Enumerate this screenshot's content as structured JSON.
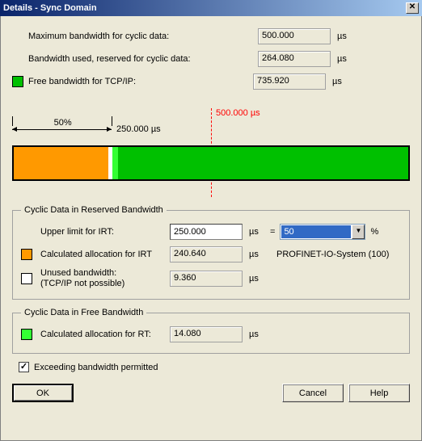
{
  "title": "Details - Sync Domain",
  "top": {
    "max_bw_label": "Maximum bandwidth for cyclic data:",
    "max_bw_value": "500.000",
    "used_bw_label": "Bandwidth used, reserved for cyclic data:",
    "used_bw_value": "264.080",
    "free_bw_label": "Free bandwidth for TCP/IP:",
    "free_bw_value": "735.920",
    "unit": "µs"
  },
  "chart_data": {
    "type": "bar",
    "total_us": 1000.0,
    "max_cyclic_us": 500.0,
    "marker_label": "500.000 µs",
    "scale_pct_label": "50%",
    "scale_us_label": "250.000 µs",
    "segments": [
      {
        "name": "calculated-irt",
        "color": "orange",
        "us": 240.64
      },
      {
        "name": "unused-reserved",
        "color": "white",
        "us": 9.36
      },
      {
        "name": "calculated-rt",
        "color": "lime",
        "us": 14.08
      },
      {
        "name": "free-tcpip",
        "color": "green",
        "us": 735.92
      }
    ]
  },
  "reserved": {
    "legend": "Cyclic Data in Reserved Bandwidth",
    "upper_label": "Upper limit for IRT:",
    "upper_value": "250.000",
    "pct_value": "50",
    "calc_irt_label": "Calculated allocation for IRT",
    "calc_irt_value": "240.640",
    "system_name": "PROFINET-IO-System (100)",
    "unused_label_l1": "Unused bandwidth:",
    "unused_label_l2": "(TCP/IP not possible)",
    "unused_value": "9.360",
    "unit": "µs",
    "eq": "="
  },
  "free": {
    "legend": "Cyclic Data in Free Bandwidth",
    "calc_rt_label": "Calculated allocation for RT:",
    "calc_rt_value": "14.080",
    "unit": "µs"
  },
  "exceed_label": "Exceeding bandwidth permitted",
  "exceed_checked": true,
  "buttons": {
    "ok": "OK",
    "cancel": "Cancel",
    "help": "Help"
  },
  "pct_sign": "%"
}
